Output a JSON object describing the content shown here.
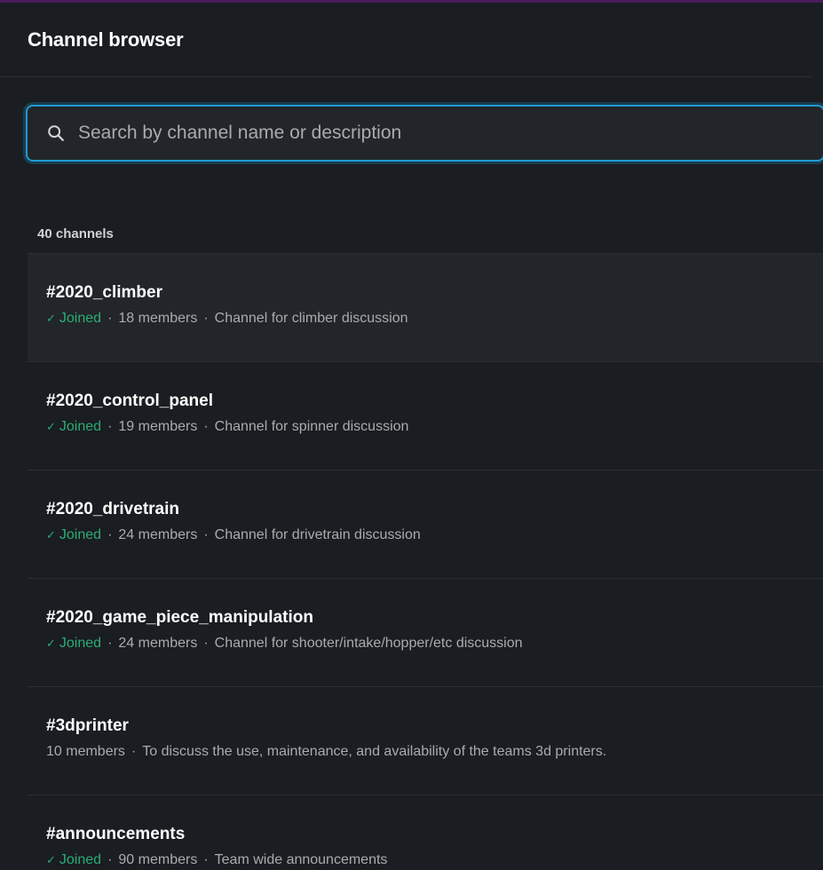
{
  "header": {
    "title": "Channel browser"
  },
  "search": {
    "placeholder": "Search by channel name or description",
    "value": ""
  },
  "count_label": "40 channels",
  "separator": "·",
  "joined_check": "✓",
  "joined_label": "Joined",
  "channels": [
    {
      "name": "#2020_climber",
      "joined": true,
      "members": "18 members",
      "description": "Channel for climber discussion"
    },
    {
      "name": "#2020_control_panel",
      "joined": true,
      "members": "19 members",
      "description": "Channel for spinner discussion"
    },
    {
      "name": "#2020_drivetrain",
      "joined": true,
      "members": "24 members",
      "description": "Channel for drivetrain discussion"
    },
    {
      "name": "#2020_game_piece_manipulation",
      "joined": true,
      "members": "24 members",
      "description": "Channel for shooter/intake/hopper/etc discussion"
    },
    {
      "name": "#3dprinter",
      "joined": false,
      "members": "10 members",
      "description": "To discuss the use, maintenance, and availability of the teams 3d printers."
    },
    {
      "name": "#announcements",
      "joined": true,
      "members": "90 members",
      "description": "Team wide announcements"
    }
  ],
  "colors": {
    "accent": "#1d9bd1",
    "joined": "#2bac76",
    "background": "#1a1d21"
  }
}
